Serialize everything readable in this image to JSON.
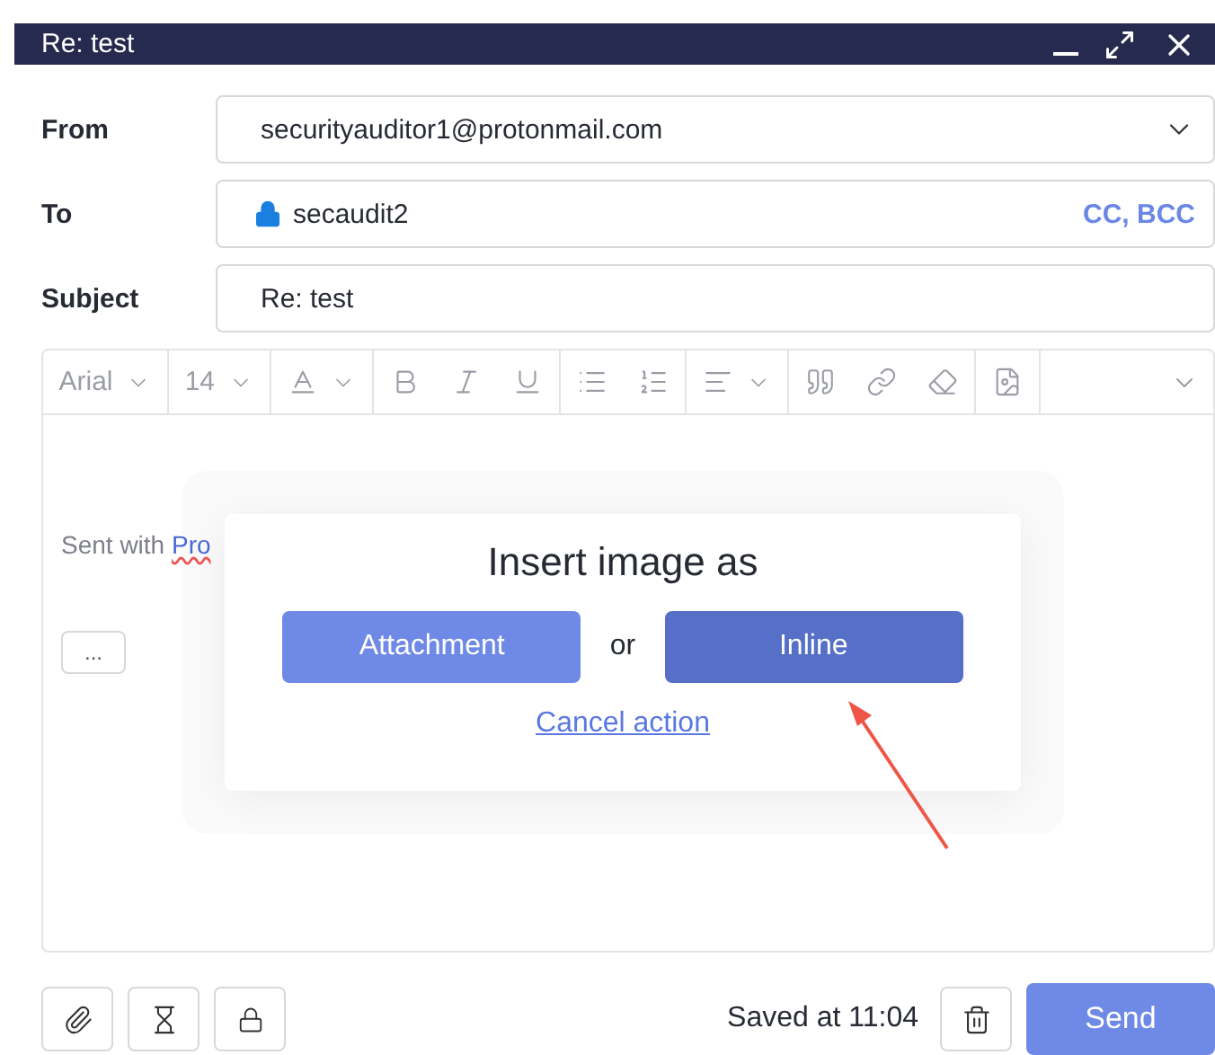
{
  "window": {
    "title": "Re: test"
  },
  "fields": [
    {
      "kind": "select",
      "label": "From",
      "value": "securityauditor1@protonmail.com"
    },
    {
      "kind": "recipients",
      "label": "To",
      "value": "secaudit2",
      "action": "CC, BCC"
    },
    {
      "kind": "text",
      "label": "Subject",
      "value": "Re: test"
    }
  ],
  "toolbar": {
    "font": "Arial",
    "size": "14"
  },
  "editor": {
    "signature": "Sent with",
    "link": "Pro",
    "more": "..."
  },
  "modal": {
    "title": "Insert image as",
    "options": [
      {
        "label": "Attachment",
        "selected": false
      },
      {
        "label": "Inline",
        "selected": true
      }
    ],
    "or": "or",
    "cancel": "Cancel action"
  },
  "footer": {
    "saved": "Saved at 11:04",
    "send": "Send"
  }
}
